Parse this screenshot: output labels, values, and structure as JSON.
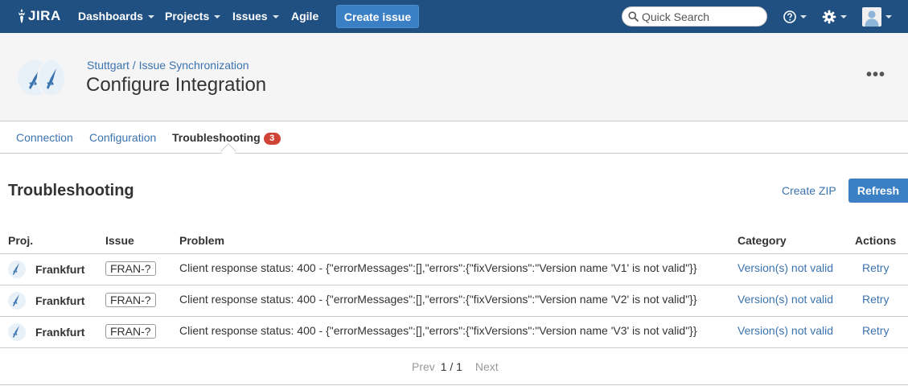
{
  "nav": {
    "logo_text": "JIRA",
    "items": [
      {
        "label": "Dashboards",
        "dropdown": true
      },
      {
        "label": "Projects",
        "dropdown": true
      },
      {
        "label": "Issues",
        "dropdown": true
      },
      {
        "label": "Agile",
        "dropdown": false
      }
    ],
    "create_label": "Create issue",
    "search_placeholder": "Quick Search",
    "help_icon": "help-icon",
    "settings_icon": "gear-icon",
    "user_icon": "user-avatar-icon",
    "colors": {
      "bar": "#205081",
      "button": "#3b7fc4"
    }
  },
  "header": {
    "breadcrumb": "Stuttgart / Issue Synchronization",
    "title": "Configure Integration",
    "more_label": "•••"
  },
  "tabs": [
    {
      "label": "Connection",
      "active": false
    },
    {
      "label": "Configuration",
      "active": false
    },
    {
      "label": "Troubleshooting",
      "active": true,
      "badge": "3"
    }
  ],
  "section": {
    "title": "Troubleshooting",
    "zip_label": "Create ZIP",
    "refresh_label": "Refresh"
  },
  "table": {
    "headers": {
      "proj": "Proj.",
      "issue": "Issue",
      "problem": "Problem",
      "category": "Category",
      "actions": "Actions"
    },
    "rows": [
      {
        "project": "Frankfurt",
        "issue": "FRAN-?",
        "problem": "Client response status: 400 - {\"errorMessages\":[],\"errors\":{\"fixVersions\":\"Version name 'V1' is not valid\"}}",
        "category": "Version(s) not valid",
        "action": "Retry"
      },
      {
        "project": "Frankfurt",
        "issue": "FRAN-?",
        "problem": "Client response status: 400 - {\"errorMessages\":[],\"errors\":{\"fixVersions\":\"Version name 'V2' is not valid\"}}",
        "category": "Version(s) not valid",
        "action": "Retry"
      },
      {
        "project": "Frankfurt",
        "issue": "FRAN-?",
        "problem": "Client response status: 400 - {\"errorMessages\":[],\"errors\":{\"fixVersions\":\"Version name 'V3' is not valid\"}}",
        "category": "Version(s) not valid",
        "action": "Retry"
      }
    ]
  },
  "pager": {
    "prev": "Prev",
    "current": "1 / 1",
    "next": "Next"
  }
}
